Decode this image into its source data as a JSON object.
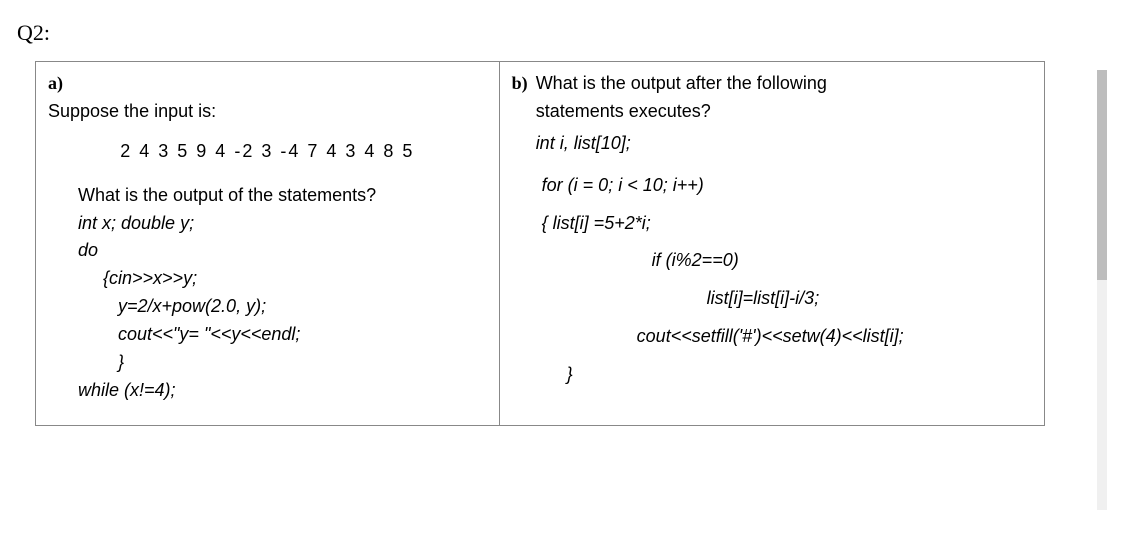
{
  "question_label": "Q2:",
  "a": {
    "part": "a)",
    "intro": "Suppose the input is:",
    "input_line": "2 4 3 5 9 4 -2 3 -4 7 4 3 4 8 5",
    "question": "What is the output of the statements?",
    "code": {
      "l1": "int x; double y;",
      "l2": "do",
      "l3": "{cin>>x>>y;",
      "l4": "y=2/x+pow(2.0, y);",
      "l5": "cout<<\"y= \"<<y<<endl;",
      "l6": "}",
      "l7": "while (x!=4);"
    }
  },
  "b": {
    "part": "b)",
    "q_line1": "What is the output after the following",
    "q_line2": "statements executes?",
    "code": {
      "l1": "int i, list[10];",
      "l2": "for (i = 0; i < 10; i++)",
      "l3": "{ list[i] =5+2*i;",
      "l4": "if (i%2==0)",
      "l5": "list[i]=list[i]-i/3;",
      "l6": "cout<<setfill('#')<<setw(4)<<list[i];",
      "l7": "}"
    }
  }
}
